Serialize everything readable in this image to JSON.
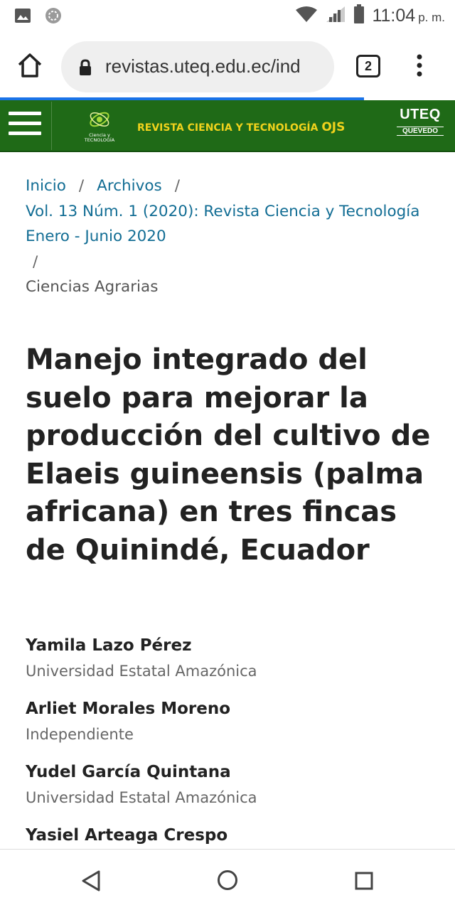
{
  "status_bar": {
    "time": "11:04",
    "ampm": "p. m.",
    "icons": [
      "image-icon",
      "settings-gear-icon",
      "wifi-icon",
      "signal-icon",
      "battery-icon"
    ]
  },
  "browser": {
    "url": "revistas.uteq.edu.ec/ind",
    "tab_count": "2",
    "progress": 0.8,
    "accent_color": "#1a73e8"
  },
  "site_header": {
    "journal_logo_text": "Ciencia y TECNOLOGÍA",
    "journal_name": "REVISTA CIENCIA Y TECNOLOGÍA",
    "journal_name_suffix": "OJS",
    "university_logo": "UTEQ",
    "university_city": "QUEVEDO",
    "brand_color": "#1f6a17",
    "title_color": "#f0d21c"
  },
  "breadcrumb": {
    "items": [
      "Inicio",
      "Archivos",
      "Vol. 13 Núm. 1 (2020): Revista Ciencia y Tecnología Enero - Junio 2020",
      "Ciencias Agrarias"
    ],
    "separator": "/"
  },
  "article": {
    "title": "Manejo integrado del suelo para mejorar la producción del cultivo de Elaeis guineensis (palma africana) en tres fincas de Quinindé, Ecuador",
    "authors": [
      {
        "name": "Yamila Lazo Pérez",
        "affiliation": "Universidad Estatal Amazónica"
      },
      {
        "name": "Arliet Morales Moreno",
        "affiliation": "Independiente"
      },
      {
        "name": "Yudel García Quintana",
        "affiliation": "Universidad Estatal Amazónica"
      },
      {
        "name": "Yasiel Arteaga Crespo",
        "affiliation": ""
      }
    ]
  },
  "nav_bar": {
    "buttons": [
      "back-icon",
      "home-icon",
      "recents-icon"
    ]
  }
}
